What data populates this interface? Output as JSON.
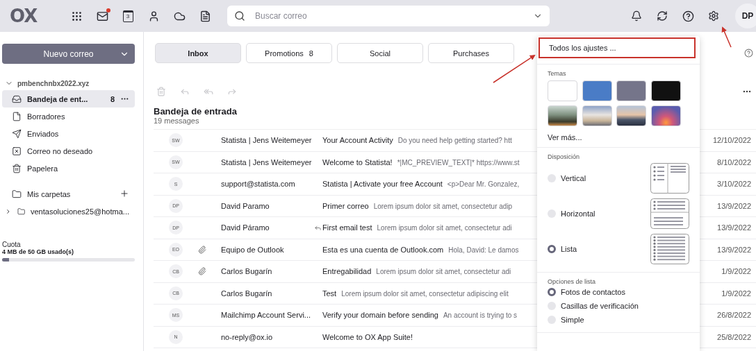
{
  "topbar": {
    "logo": "OX",
    "apps": [
      {
        "kind": "grid"
      },
      {
        "kind": "mail",
        "notification": true
      },
      {
        "kind": "calendar",
        "label": "3"
      },
      {
        "kind": "contacts"
      },
      {
        "kind": "drive"
      },
      {
        "kind": "documents"
      }
    ],
    "search": {
      "placeholder": "Buscar correo"
    },
    "actions": [
      {
        "kind": "bell"
      },
      {
        "kind": "refresh"
      },
      {
        "kind": "help"
      },
      {
        "kind": "settings"
      }
    ],
    "user": {
      "initials": "DP"
    }
  },
  "sidebar": {
    "compose": "Nuevo correo",
    "account": {
      "name": "pmbenchnbx2022.xyz",
      "expanded": true
    },
    "folders": [
      {
        "kind": "inbox",
        "label": "Bandeja de ent...",
        "count": "8",
        "selected": true
      },
      {
        "kind": "drafts",
        "label": "Borradores",
        "selected": false
      },
      {
        "kind": "sent",
        "label": "Enviados",
        "selected": false
      },
      {
        "kind": "spam",
        "label": "Correo no deseado",
        "selected": false
      },
      {
        "kind": "trash",
        "label": "Papelera",
        "selected": false
      }
    ],
    "my_folders": "Mis carpetas",
    "accounts": [
      {
        "label": "ventasoluciones25@hotma...",
        "expanded": false
      }
    ],
    "quota": {
      "title": "Cuota",
      "usage": "4 MB de 50 GB usado(s)",
      "level": 0.05
    }
  },
  "tabs": [
    {
      "label": "Inbox",
      "selected": true
    },
    {
      "label": "Promotions",
      "count": "8",
      "selected": false
    },
    {
      "label": "Social",
      "selected": false
    },
    {
      "label": "Purchases",
      "selected": false
    }
  ],
  "list": {
    "title": "Bandeja de entrada",
    "count": "19 messages",
    "messages": [
      {
        "initials": "SW",
        "sender": "Statista | Jens Weitemeyer",
        "subject": "Your Account Activity",
        "preview": "Do you need help getting started? htt",
        "date": "12/10/2022",
        "attachment": false,
        "replied": false
      },
      {
        "initials": "SW",
        "sender": "Statista | Jens Weitemeyer",
        "subject": "Welcome to Statista!",
        "preview": "*|MC_PREVIEW_TEXT|* https://www.st",
        "date": "8/10/2022",
        "attachment": false,
        "replied": false
      },
      {
        "initials": "S",
        "sender": "support@statista.com",
        "subject": "Statista | Activate your free Account",
        "preview": "<p>Dear Mr. Gonzalez,",
        "date": "3/10/2022",
        "attachment": false,
        "replied": false
      },
      {
        "initials": "DP",
        "sender": "David Paramo",
        "subject": "Primer correo",
        "preview": "Lorem ipsum dolor sit amet, consectetur adip",
        "date": "13/9/2022",
        "attachment": false,
        "replied": false
      },
      {
        "initials": "DP",
        "sender": "David Páramo",
        "subject": "First email test",
        "preview": "Lorem ipsum dolor sit amet, consectetur adi",
        "date": "13/9/2022",
        "attachment": false,
        "replied": true
      },
      {
        "initials": "EO",
        "sender": "Equipo de Outlook",
        "subject": "Esta es una cuenta de Outlook.com",
        "preview": "Hola, David:  Le damos",
        "date": "13/9/2022",
        "attachment": true,
        "replied": false
      },
      {
        "initials": "CB",
        "sender": "Carlos Bugarín",
        "subject": "Entregabilidad",
        "preview": "Lorem ipsum dolor sit amet, consectetur adi",
        "date": "1/9/2022",
        "attachment": true,
        "replied": false
      },
      {
        "initials": "CB",
        "sender": "Carlos Bugarín",
        "subject": "Test",
        "preview": "Lorem ipsum dolor sit amet, consectetur adipiscing elit",
        "date": "1/9/2022",
        "attachment": false,
        "replied": false
      },
      {
        "initials": "MS",
        "sender": "Mailchimp Account Servi...",
        "subject": "Verify your domain before sending",
        "preview": "An account is trying to s",
        "date": "26/8/2022",
        "attachment": false,
        "replied": false
      },
      {
        "initials": "N",
        "sender": "no-reply@ox.io",
        "subject": "Welcome to OX App Suite!",
        "date": "25/8/2022",
        "attachment": false,
        "replied": false
      }
    ]
  },
  "settings_menu": {
    "all_settings": {
      "label": "Todos los ajustes ...",
      "highlighted": true
    },
    "themes_title": "Temas",
    "themes": [
      {
        "kind": "color",
        "color": "#ffffff"
      },
      {
        "kind": "color",
        "color": "#4a7cc6"
      },
      {
        "kind": "color",
        "color": "#75758a"
      },
      {
        "kind": "color",
        "color": "#111111"
      },
      {
        "kind": "photo"
      },
      {
        "kind": "photo"
      },
      {
        "kind": "photo"
      },
      {
        "kind": "photo"
      }
    ],
    "more": "Ver más...",
    "layout_title": "Disposición",
    "layouts": [
      {
        "kind": "vertical",
        "label": "Vertical",
        "selected": false
      },
      {
        "kind": "horizontal",
        "label": "Horizontal",
        "selected": false
      },
      {
        "kind": "list",
        "label": "Lista",
        "selected": true
      }
    ],
    "list_options_title": "Opciones de lista",
    "list_options": [
      {
        "label": "Fotos de contactos",
        "selected": true
      },
      {
        "label": "Casillas de verificación",
        "selected": false
      },
      {
        "label": "Simple",
        "selected": false
      }
    ]
  }
}
